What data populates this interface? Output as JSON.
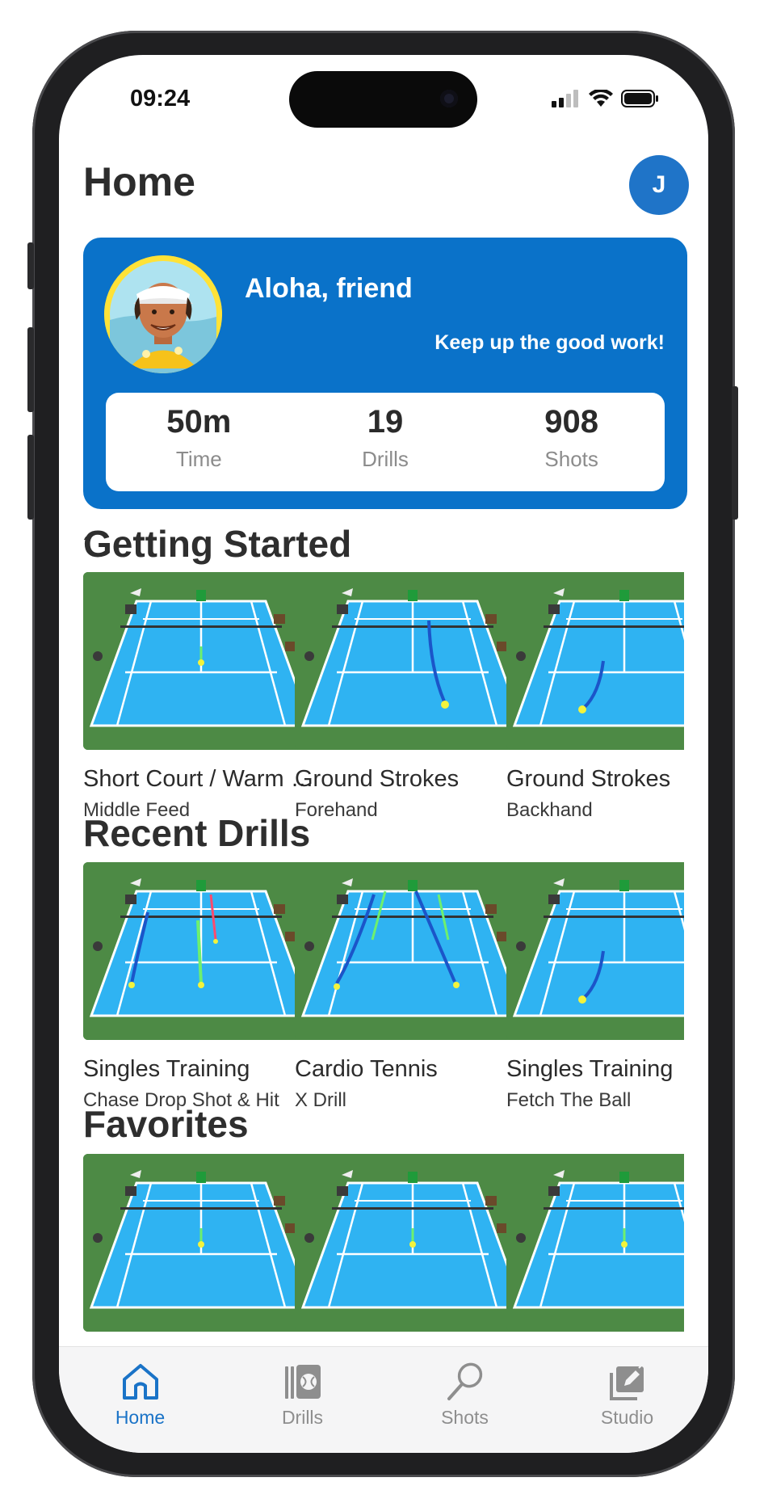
{
  "status_bar": {
    "time": "09:24"
  },
  "header": {
    "title": "Home",
    "avatar_initial": "J"
  },
  "hero": {
    "greeting": "Aloha, friend",
    "message": "Keep up the good work!",
    "stats": [
      {
        "value": "50m",
        "label": "Time"
      },
      {
        "value": "19",
        "label": "Drills"
      },
      {
        "value": "908",
        "label": "Shots"
      }
    ]
  },
  "sections": {
    "getting_started": {
      "title": "Getting Started",
      "items": [
        {
          "title": "Short Court / Warm Up",
          "subtitle": "Middle Feed"
        },
        {
          "title": "Ground Strokes",
          "subtitle": "Forehand"
        },
        {
          "title": "Ground Strokes",
          "subtitle": "Backhand"
        }
      ]
    },
    "recent_drills": {
      "title": "Recent Drills",
      "items": [
        {
          "title": "Singles Training",
          "subtitle": "Chase Drop Shot & Hit"
        },
        {
          "title": "Cardio Tennis",
          "subtitle": "X Drill"
        },
        {
          "title": "Singles Training",
          "subtitle": "Fetch The Ball"
        }
      ]
    },
    "favorites": {
      "title": "Favorites"
    }
  },
  "tabbar": {
    "tabs": [
      {
        "label": "Home",
        "icon": "home-icon",
        "active": true
      },
      {
        "label": "Drills",
        "icon": "drills-icon",
        "active": false
      },
      {
        "label": "Shots",
        "icon": "racket-icon",
        "active": false
      },
      {
        "label": "Studio",
        "icon": "studio-icon",
        "active": false
      }
    ]
  },
  "colors": {
    "accent": "#0a72c9",
    "court": "#2fb3f2",
    "grass": "#4d8a45",
    "tab_inactive": "#8e8e8e"
  }
}
